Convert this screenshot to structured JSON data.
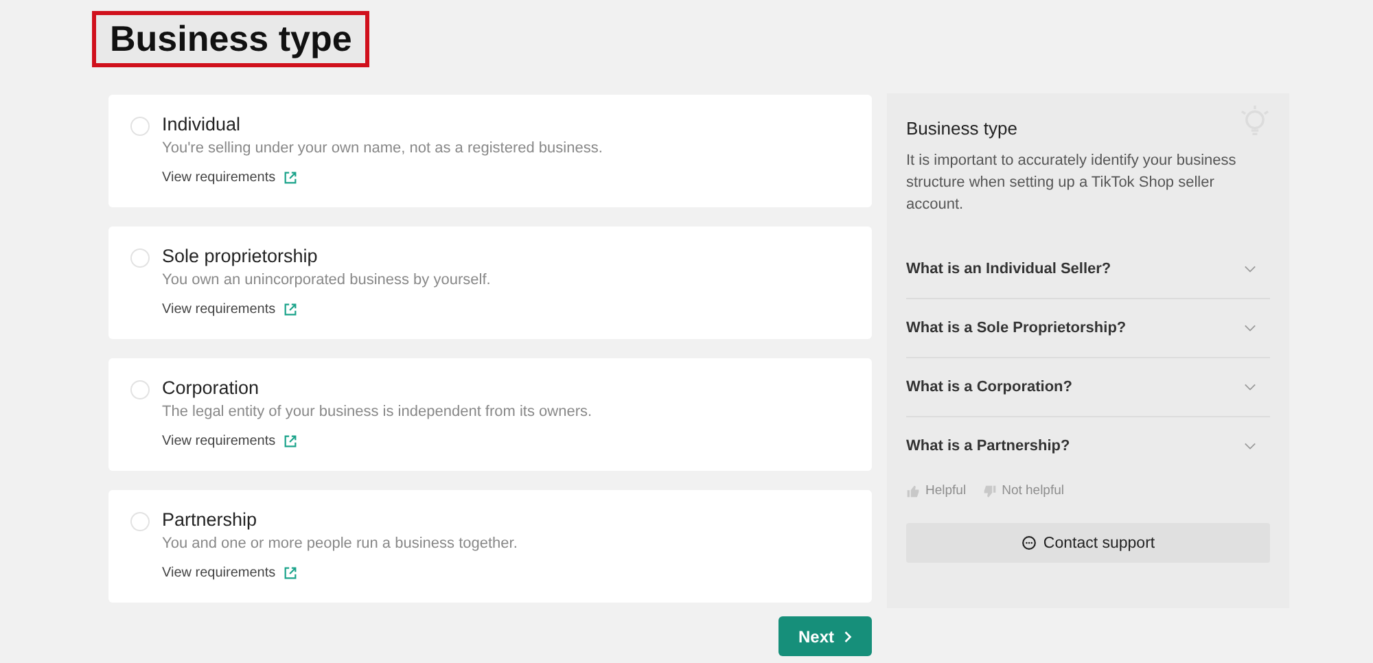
{
  "heading": {
    "text": "Business type",
    "highlighted": true
  },
  "options": [
    {
      "title": "Individual",
      "description": "You're selling under your own name, not as a registered business.",
      "link": "View requirements",
      "selected": false
    },
    {
      "title": "Sole proprietorship",
      "description": "You own an unincorporated business by yourself.",
      "link": "View requirements",
      "selected": false
    },
    {
      "title": "Corporation",
      "description": "The legal entity of your business is independent from its owners.",
      "link": "View requirements",
      "selected": false
    },
    {
      "title": "Partnership",
      "description": "You and one or more people run a business together.",
      "link": "View requirements",
      "selected": false
    }
  ],
  "next_button": "Next",
  "help_panel": {
    "title": "Business type",
    "intro": "It is important to accurately identify your business structure when setting up a TikTok Shop seller account.",
    "faqs": [
      {
        "question": "What is an Individual Seller?",
        "expanded": false
      },
      {
        "question": "What is a Sole Proprietorship?",
        "expanded": false
      },
      {
        "question": "What is a Corporation?",
        "expanded": false
      },
      {
        "question": "What is a Partnership?",
        "expanded": false
      }
    ],
    "feedback": [
      "Helpful",
      "Not helpful"
    ],
    "contact_button": "Contact support"
  }
}
